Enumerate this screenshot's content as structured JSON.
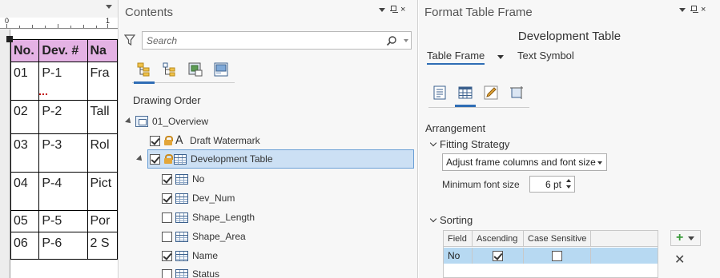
{
  "layout_view": {
    "ruler_labels": [
      "0",
      "1"
    ],
    "table": {
      "headers": [
        "No.",
        "Dev. #",
        "Na"
      ],
      "rows": [
        [
          "01",
          "P-1",
          "Fra"
        ],
        [
          "02",
          "P-2",
          "Tall"
        ],
        [
          "03",
          "P-3",
          "Rol"
        ],
        [
          "04",
          "P-4",
          "Pict"
        ],
        [
          "05",
          "P-5",
          "Por"
        ],
        [
          "06",
          "P-6",
          "2 S"
        ]
      ]
    }
  },
  "contents": {
    "title": "Contents",
    "search_placeholder": "Search",
    "section_label": "Drawing Order",
    "tree": {
      "map_frame": "01_Overview",
      "watermark": "Draft Watermark",
      "table_frame": "Development Table",
      "fields": [
        {
          "label": "No",
          "checked": true
        },
        {
          "label": "Dev_Num",
          "checked": true
        },
        {
          "label": "Shape_Length",
          "checked": false
        },
        {
          "label": "Shape_Area",
          "checked": false
        },
        {
          "label": "Name",
          "checked": true
        },
        {
          "label": "Status",
          "checked": false
        }
      ]
    }
  },
  "format": {
    "title": "Format Table Frame",
    "element_name": "Development Table",
    "tabs": [
      "Table Frame",
      "Text Symbol"
    ],
    "arrangement_label": "Arrangement",
    "fitting_label": "Fitting Strategy",
    "fitting_value": "Adjust frame columns and font size",
    "min_font_label": "Minimum font size",
    "min_font_value": "6 pt",
    "sorting_label": "Sorting",
    "sort_headers": [
      "Field",
      "Ascending",
      "Case Sensitive"
    ],
    "sort_row": {
      "field": "No",
      "ascending": true,
      "case_sensitive": false
    }
  },
  "colors": {
    "header_fill": "#e4b2e4",
    "selection": "#cce0f4",
    "sort_row": "#b7d9f2",
    "accent": "#2f6db5"
  }
}
